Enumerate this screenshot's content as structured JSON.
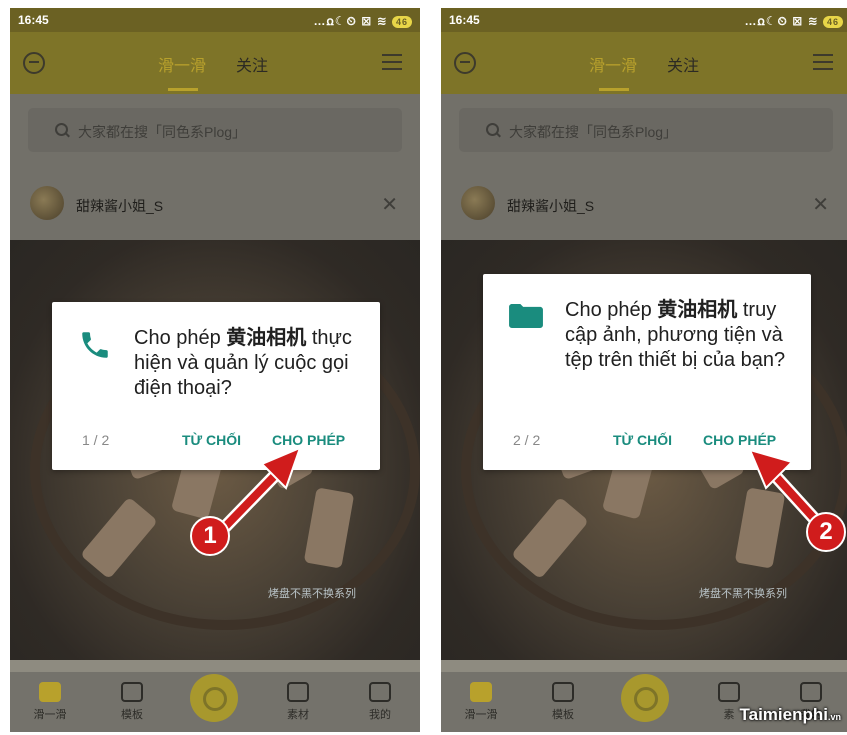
{
  "phones": [
    {
      "status_time": "16:45",
      "status_icons": "…ꭥ☾⏲ ⊠ ≋",
      "battery": "46",
      "tab_active": "滑一滑",
      "tab_follow": "关注",
      "search_text": "大家都在搜「同色系Plog」",
      "username": "甜辣酱小姐_S",
      "close_symbol": "✕",
      "overlay_caption": "烤盘不黑不换系列",
      "dialog_prefix": "Cho phép ",
      "app_name": "黄油相机",
      "dialog_message": "thực hiện và quản lý cuộc gọi điện thoại?",
      "counter": "1 / 2",
      "deny_label": "TỪ CHỐI",
      "allow_label": "CHO PHÉP",
      "badge": "1",
      "nav": [
        "滑一滑",
        "模板",
        "素材",
        "我的"
      ]
    },
    {
      "status_time": "16:45",
      "status_icons": "…ꭥ☾⏲ ⊠ ≋",
      "battery": "46",
      "tab_active": "滑一滑",
      "tab_follow": "关注",
      "search_text": "大家都在搜「同色系Plog」",
      "username": "甜辣酱小姐_S",
      "close_symbol": "✕",
      "overlay_caption": "烤盘不黑不换系列",
      "dialog_prefix": "Cho phép ",
      "app_name": "黄油相机",
      "dialog_message": "truy cập ảnh, phương tiện và tệp trên thiết bị của bạn?",
      "counter": "2 / 2",
      "deny_label": "TỪ CHỐI",
      "allow_label": "CHO PHÉP",
      "badge": "2",
      "nav": [
        "滑一滑",
        "模板",
        "素",
        "我的"
      ]
    }
  ],
  "watermark": {
    "brand": "aimienphi",
    "initial": "T",
    "tld": ".vn"
  },
  "colors": {
    "accent": "#1a8c7e",
    "arrow": "#d01c1c",
    "appbar": "#7e7428"
  }
}
